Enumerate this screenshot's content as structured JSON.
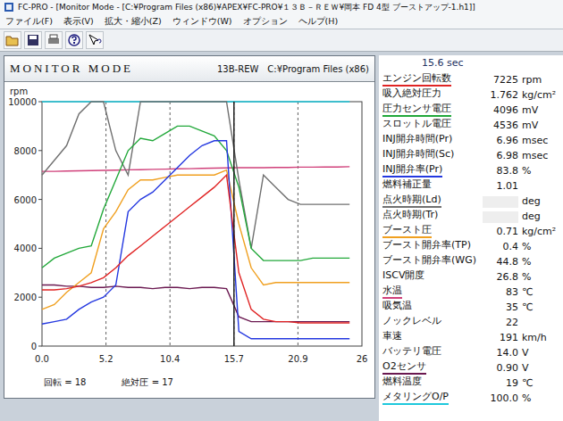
{
  "window": {
    "title": "FC-PRO - [Monitor Mode - [C:¥Program Files (x86)¥APEX¥FC-PRO¥１３Ｂ－ＲＥＷ¥岡本 FD 4型 ブーストアップ-1.h1]]"
  },
  "menu": [
    "ファイル(F)",
    "表示(V)",
    "拡大・縮小(Z)",
    "ウィンドウ(W)",
    "オプション",
    "ヘルプ(H)"
  ],
  "chart_window": {
    "title": "MONITOR MODE",
    "engine": "13B-REW",
    "path": "C:¥Program Files (x86)"
  },
  "chart": {
    "y_unit": "rpm",
    "y_ticks": [
      "10000",
      "8000",
      "6000",
      "4000",
      "2000",
      "0"
    ],
    "y_max": 10000,
    "x_ticks": [
      "0.0",
      "5.2",
      "10.4",
      "15.7",
      "20.9",
      "26"
    ],
    "cursor": {
      "level": 0.6
    },
    "series": [
      {
        "color": "#1ec8dc",
        "values": [
          10000,
          10000,
          10000,
          10000,
          10000,
          10000,
          10000,
          10000,
          10000,
          10000,
          10000,
          10000,
          10000,
          10000,
          10000,
          10000,
          10000,
          10000,
          10000,
          10000,
          10000,
          10000,
          10000,
          10000,
          10000,
          10000
        ]
      },
      {
        "color": "#d0407a",
        "values": [
          7150,
          7150,
          7160,
          7170,
          7180,
          7190,
          7200,
          7210,
          7220,
          7230,
          7240,
          7250,
          7260,
          7270,
          7280,
          7290,
          7300,
          7300,
          7300,
          7310,
          7310,
          7320,
          7320,
          7330,
          7330,
          7340
        ]
      },
      {
        "color": "#6a1850",
        "values": [
          2500,
          2500,
          2450,
          2450,
          2400,
          2400,
          2450,
          2400,
          2400,
          2350,
          2400,
          2400,
          2350,
          2400,
          2400,
          2350,
          1200,
          1000,
          1000,
          1000,
          1000,
          1000,
          1000,
          1000,
          1000,
          1000
        ]
      },
      {
        "color": "#707070",
        "values": [
          7000,
          7600,
          8200,
          9500,
          10000,
          10000,
          8000,
          7000,
          10000,
          10000,
          10000,
          10000,
          10000,
          10000,
          10000,
          10000,
          6800,
          4000,
          7000,
          6500,
          6000,
          5800,
          5800,
          5800,
          5800,
          5800
        ]
      },
      {
        "color": "#f0a020",
        "values": [
          1500,
          1700,
          2200,
          2600,
          3000,
          4800,
          5500,
          6400,
          6800,
          6800,
          6900,
          7000,
          7000,
          7000,
          7000,
          7200,
          5000,
          3200,
          2500,
          2600,
          2600,
          2600,
          2600,
          2600,
          2600,
          2600
        ]
      },
      {
        "color": "#22a83a",
        "values": [
          3200,
          3600,
          3800,
          4000,
          4100,
          5600,
          6800,
          8000,
          8500,
          8400,
          8700,
          9000,
          9000,
          8800,
          8600,
          8000,
          6500,
          4000,
          3500,
          3500,
          3500,
          3500,
          3600,
          3600,
          3600,
          3600
        ]
      },
      {
        "color": "#2438e0",
        "values": [
          900,
          1000,
          1100,
          1500,
          1800,
          2000,
          2500,
          5500,
          6000,
          6300,
          6800,
          7300,
          7800,
          8200,
          8400,
          8400,
          600,
          300,
          300,
          300,
          300,
          300,
          300,
          300,
          300,
          300
        ]
      },
      {
        "color": "#e02424",
        "values": [
          2300,
          2300,
          2350,
          2450,
          2600,
          2800,
          3200,
          3700,
          4100,
          4500,
          4900,
          5300,
          5700,
          6100,
          6500,
          7000,
          3000,
          1500,
          1100,
          1000,
          1000,
          950,
          950,
          950,
          950,
          950
        ]
      }
    ],
    "footer": [
      "回転 = 18",
      "絶対圧 = 17"
    ]
  },
  "readout": {
    "time": "15.6 sec",
    "params": [
      {
        "label": "エンジン回転数",
        "value": "7225",
        "unit": "rpm",
        "color": "#e02424"
      },
      {
        "label": "吸入絶対圧力",
        "value": "1.762",
        "unit": "kg/cm²"
      },
      {
        "label": "圧力センサ電圧",
        "value": "4096",
        "unit": "mV",
        "color": "#22a83a"
      },
      {
        "label": "スロットル電圧",
        "value": "4536",
        "unit": "mV"
      },
      {
        "label": "INJ開弁時間(Pr)",
        "value": "6.96",
        "unit": "msec"
      },
      {
        "label": "INJ開弁時間(Sc)",
        "value": "6.98",
        "unit": "msec"
      },
      {
        "label": "INJ開弁率(Pr)",
        "value": "83.8",
        "unit": "%",
        "color": "#2438e0"
      },
      {
        "label": "燃料補正量",
        "value": "1.01",
        "unit": ""
      },
      {
        "label": "点火時期(Ld)",
        "value": "",
        "unit": "deg",
        "color": "#707070"
      },
      {
        "label": "点火時期(Tr)",
        "value": "",
        "unit": "deg"
      },
      {
        "label": "ブースト圧",
        "value": "0.71",
        "unit": "kg/cm²",
        "color": "#f0a020"
      },
      {
        "label": "ブースト開弁率(TP)",
        "value": "0.4",
        "unit": "%"
      },
      {
        "label": "ブースト開弁率(WG)",
        "value": "44.8",
        "unit": "%"
      },
      {
        "label": "ISCV開度",
        "value": "26.8",
        "unit": "%"
      },
      {
        "label": "水温",
        "value": "83",
        "unit": "℃",
        "color": "#d0407a"
      },
      {
        "label": "吸気温",
        "value": "35",
        "unit": "℃"
      },
      {
        "label": "ノックレベル",
        "value": "22",
        "unit": ""
      },
      {
        "label": "車速",
        "value": "191",
        "unit": "km/h"
      },
      {
        "label": "バッテリ電圧",
        "value": "14.0",
        "unit": "V"
      },
      {
        "label": "O2センサ",
        "value": "0.90",
        "unit": "V",
        "color": "#6a1850"
      },
      {
        "label": "燃料温度",
        "value": "19",
        "unit": "℃"
      },
      {
        "label": "メタリングO/P",
        "value": "100.0",
        "unit": "%",
        "color": "#1ec8dc"
      }
    ]
  }
}
